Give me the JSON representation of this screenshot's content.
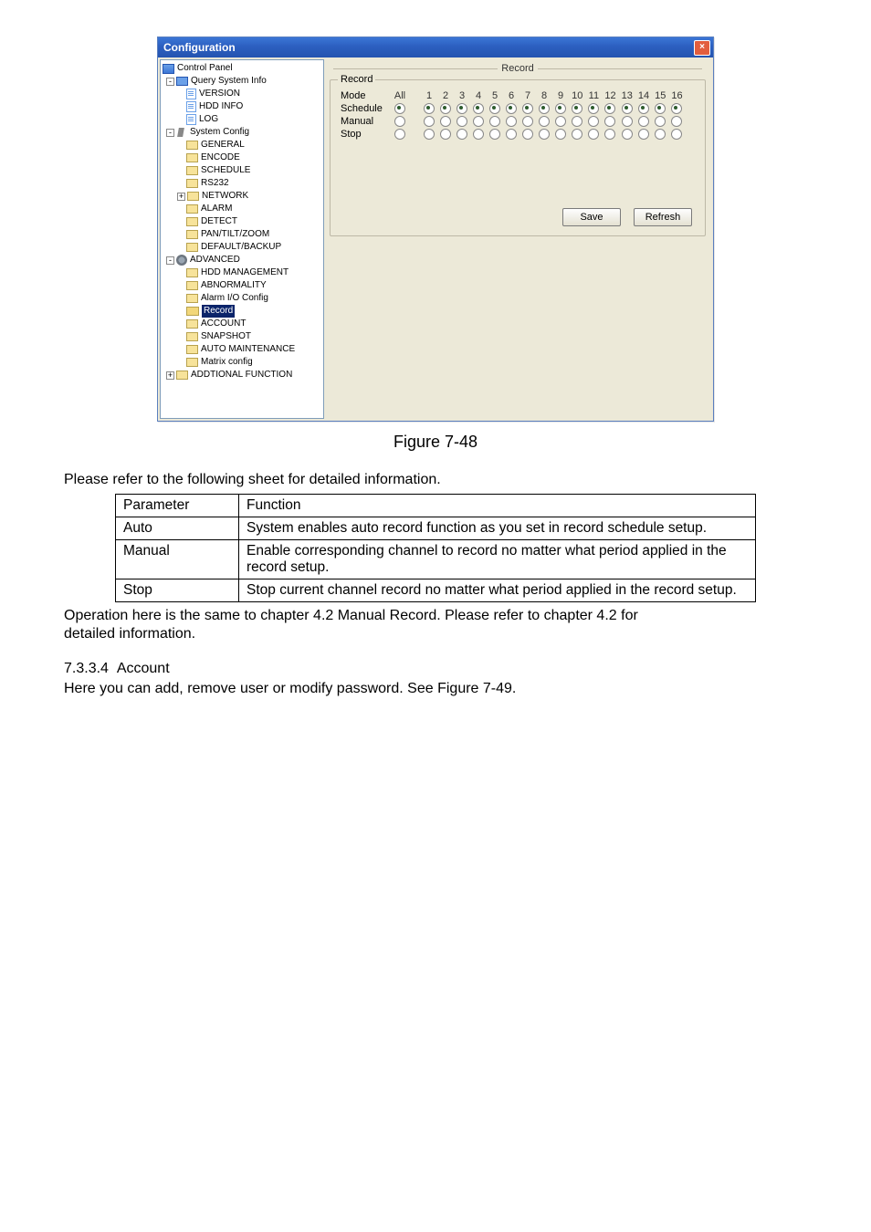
{
  "window": {
    "title": "Configuration",
    "close_glyph": "×"
  },
  "tree": {
    "root": "Control Panel",
    "query": "Query System Info",
    "query_children": [
      "VERSION",
      "HDD INFO",
      "LOG"
    ],
    "system": "System Config",
    "system_children": [
      "GENERAL",
      "ENCODE",
      "SCHEDULE",
      "RS232"
    ],
    "network": "NETWORK",
    "network_children": [
      "ALARM",
      "DETECT",
      "PAN/TILT/ZOOM",
      "DEFAULT/BACKUP"
    ],
    "advanced": "ADVANCED",
    "advanced_children": [
      "HDD MANAGEMENT",
      "ABNORMALITY",
      "Alarm I/O Config",
      "Record",
      "ACCOUNT",
      "SNAPSHOT",
      "AUTO MAINTENANCE",
      "Matrix config"
    ],
    "additional": "ADDTIONAL FUNCTION"
  },
  "record_panel": {
    "header": "Record",
    "group": "Record",
    "mode_label": "Mode",
    "all_label": "All",
    "channels": [
      "1",
      "2",
      "3",
      "4",
      "5",
      "6",
      "7",
      "8",
      "9",
      "10",
      "11",
      "12",
      "13",
      "14",
      "15",
      "16"
    ],
    "rows": [
      "Schedule",
      "Manual",
      "Stop"
    ],
    "save": "Save",
    "refresh": "Refresh"
  },
  "figure_caption": "Figure 7-48",
  "intro": "Please refer to the following sheet for detailed information.",
  "table": {
    "h1": "Parameter",
    "h2": "Function",
    "rows": [
      {
        "p": "Auto",
        "f": "System enables auto record function as you set in record schedule setup."
      },
      {
        "p": "Manual",
        "f": "Enable corresponding channel to record no matter what period applied in the record setup."
      },
      {
        "p": "Stop",
        "f": "Stop current channel record no matter what period applied in the record setup."
      }
    ]
  },
  "after_table_1": "Operation here is the same to chapter 4.2 Manual Record. Please refer to chapter 4.2 for",
  "after_table_2": "detailed information.",
  "section": {
    "num": "7.3.3.4",
    "title": "Account",
    "body": "Here you can add, remove user or modify password. See Figure 7-49."
  },
  "chart_data": {
    "type": "table",
    "title": "Record mode per channel",
    "columns": [
      "All",
      "1",
      "2",
      "3",
      "4",
      "5",
      "6",
      "7",
      "8",
      "9",
      "10",
      "11",
      "12",
      "13",
      "14",
      "15",
      "16"
    ],
    "rows": [
      "Schedule",
      "Manual",
      "Stop"
    ],
    "selected_row": "Schedule"
  }
}
